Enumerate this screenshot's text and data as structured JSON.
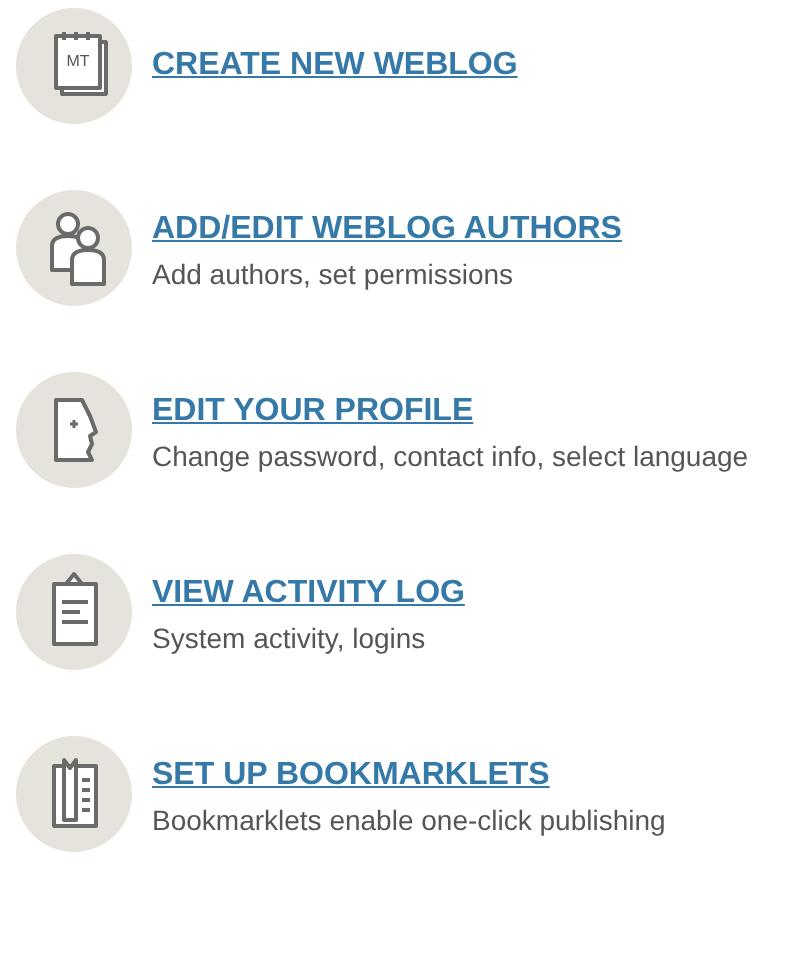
{
  "items": [
    {
      "kind": "notepad",
      "badge": "MT",
      "title": "CREATE NEW WEBLOG"
    },
    {
      "kind": "people",
      "title": "ADD/EDIT WEBLOG AUTHORS",
      "description": "Add authors, set permissions"
    },
    {
      "kind": "profile",
      "title": "EDIT YOUR PROFILE",
      "description": "Change password, contact info, select language"
    },
    {
      "kind": "clipboard",
      "title": "VIEW ACTIVITY LOG",
      "description": "System activity, logins"
    },
    {
      "kind": "bookmark",
      "title": "SET UP BOOKMARKLETS",
      "description": "Bookmarklets enable one-click publishing"
    }
  ]
}
